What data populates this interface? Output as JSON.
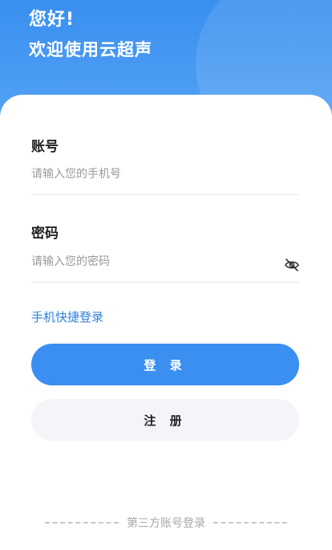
{
  "header": {
    "greeting": "您好!",
    "welcome": "欢迎使用云超声"
  },
  "account": {
    "label": "账号",
    "placeholder": "请输入您的手机号"
  },
  "password": {
    "label": "密码",
    "placeholder": "请输入您的密码",
    "toggle_icon": "eye-off-icon"
  },
  "links": {
    "quick_login": "手机快捷登录"
  },
  "buttons": {
    "login": "登 录",
    "register": "注 册"
  },
  "third_party": {
    "label": "第三方账号登录"
  },
  "colors": {
    "primary": "#3a8ff0",
    "link": "#2f7fd9",
    "secondary_bg": "#f4f5f8"
  }
}
